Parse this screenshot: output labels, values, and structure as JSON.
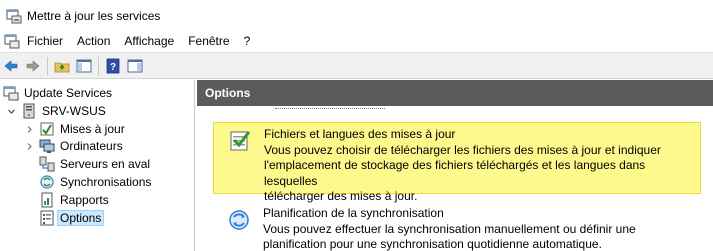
{
  "window": {
    "title": "Mettre à jour les services",
    "icon": "update-services-icon"
  },
  "menubar": {
    "items": [
      "Fichier",
      "Action",
      "Affichage",
      "Fenêtre",
      "?"
    ]
  },
  "toolbar": {
    "buttons": [
      "back-arrow-icon",
      "forward-arrow-icon",
      "up-folder-icon",
      "show-hide-tree-icon",
      "help-icon",
      "action-pane-icon"
    ]
  },
  "tree": {
    "root": "Update Services",
    "server": "SRV-WSUS",
    "items": [
      "Mises à jour",
      "Ordinateurs",
      "Serveurs en aval",
      "Synchronisations",
      "Rapports",
      "Options"
    ],
    "selected": "Options"
  },
  "content": {
    "header": "Options",
    "options": [
      {
        "title": "Fichiers et langues des mises à jour",
        "desc_lines": [
          "Vous pouvez choisir de télécharger les fichiers des mises à jour et indiquer",
          "l'emplacement de stockage des fichiers téléchargés et les langues dans lesquelles",
          "télécharger des mises à jour."
        ],
        "highlighted": true
      },
      {
        "title": "Planification de la synchronisation",
        "desc_lines": [
          "Vous pouvez effectuer la synchronisation manuellement ou définir une",
          "planification pour une synchronisation quotidienne automatique."
        ],
        "highlighted": false
      }
    ]
  },
  "colors": {
    "header_bg": "#5b5b5b",
    "highlight_bg": "#fdf98c",
    "selection_bg": "#cce8ff"
  }
}
